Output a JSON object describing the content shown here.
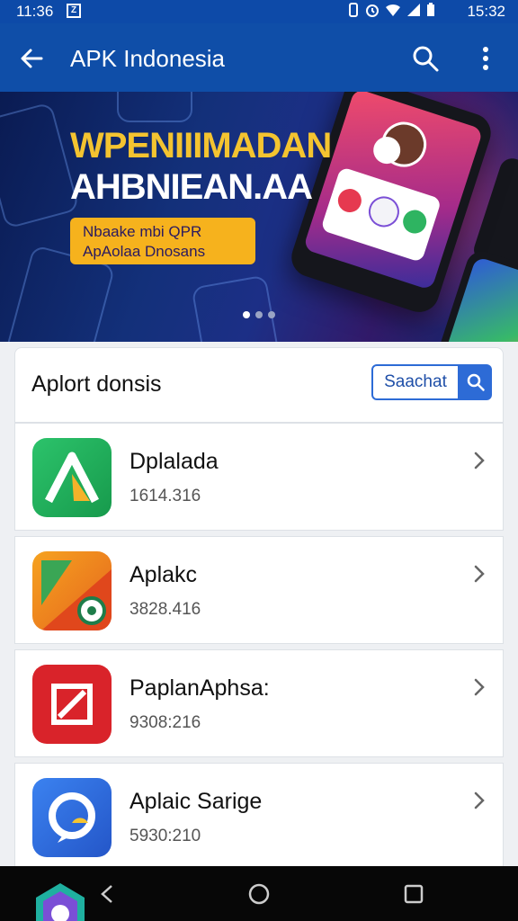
{
  "status_bar": {
    "time_left": "11:36",
    "time_right": "15:32",
    "badge_label": "Z"
  },
  "app_bar": {
    "title": "APK Indonesia"
  },
  "banner": {
    "headline_1": "WPENIIIMADAN",
    "headline_2": "AHBNIEAN.AA",
    "cta_line_1": "Nbaake mbi QPR",
    "cta_line_2": "ApAolaa Dnosans"
  },
  "section": {
    "title": "Aplort donsis",
    "search_label": "Saachat"
  },
  "apps": [
    {
      "name": "Dplalada",
      "meta": "1614.316",
      "icon": "green-triangle-app-icon",
      "color": "#1fa85a"
    },
    {
      "name": "Aplakc",
      "meta": "3828.416",
      "icon": "orange-map-app-icon",
      "color": "#f0a020"
    },
    {
      "name": "PaplanAphsa:",
      "meta": "9308:216",
      "icon": "red-square-app-icon",
      "color": "#d9232a"
    },
    {
      "name": "Aplaic Sarige",
      "meta": "5930:210",
      "icon": "blue-chat-app-icon",
      "color": "#2f6fdc"
    }
  ],
  "colors": {
    "primary": "#0f4ea8",
    "accent": "#2d6bd6",
    "banner_yellow": "#f4c430"
  }
}
